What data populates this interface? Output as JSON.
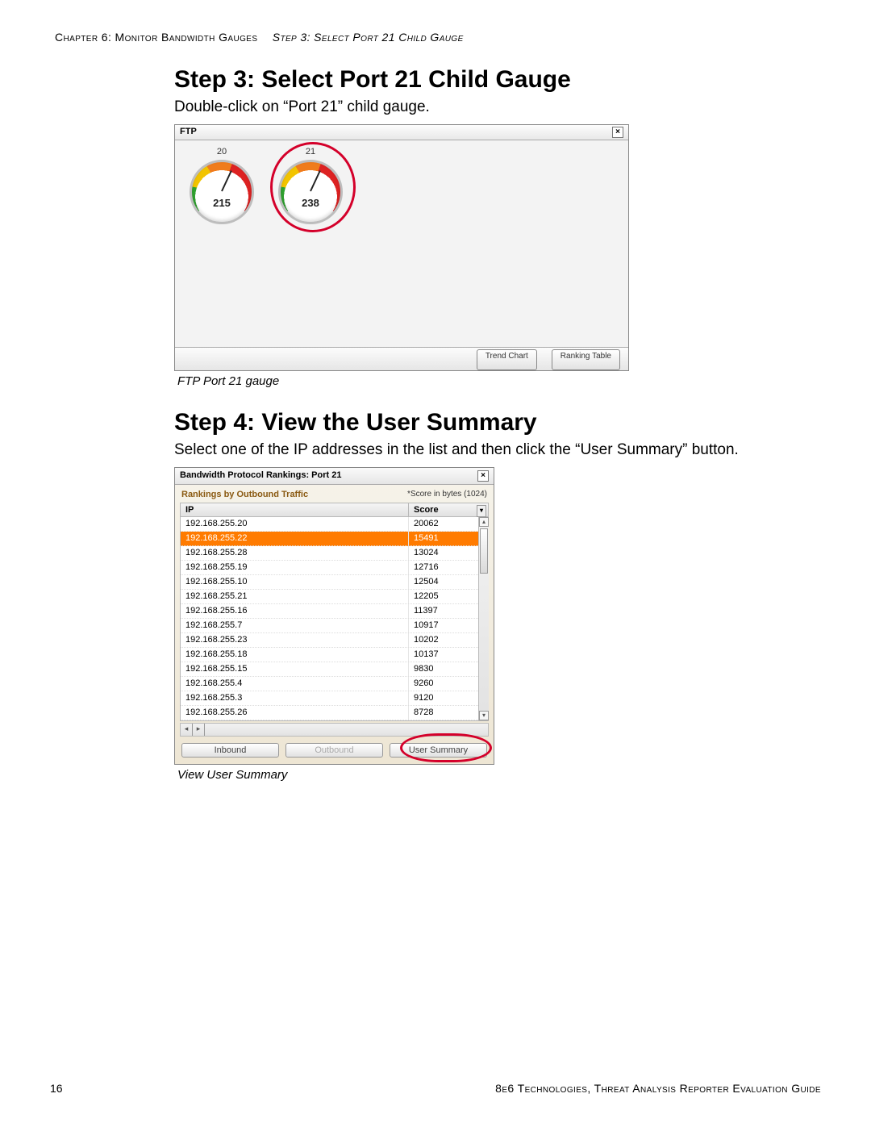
{
  "header": {
    "chapter": "Chapter 6: Monitor Bandwidth Gauges",
    "stepRef": "Step 3: Select Port 21 Child Gauge"
  },
  "step3": {
    "title": "Step 3: Select Port 21 Child Gauge",
    "body": "Double-click on “Port 21” child gauge.",
    "caption": "FTP Port 21 gauge"
  },
  "ftpPanel": {
    "title": "FTP",
    "close": "×",
    "gauges": [
      {
        "port": "20",
        "value": "215",
        "highlight": false
      },
      {
        "port": "21",
        "value": "238",
        "highlight": true
      }
    ],
    "buttons": {
      "trend": "Trend Chart",
      "ranking": "Ranking Table"
    }
  },
  "step4": {
    "title": "Step 4: View the User Summary",
    "body": "Select one of the IP addresses in the list and then click the “User Summary” button.",
    "caption": "View User Summary"
  },
  "rankPanel": {
    "title": "Bandwidth Protocol Rankings: Port 21",
    "close": "×",
    "subLeft": "Rankings by Outbound Traffic",
    "subRight": "*Score in bytes (1024)",
    "col1": "IP",
    "col2": "Score",
    "rows": [
      {
        "ip": "192.168.255.20",
        "score": "20062",
        "sel": false
      },
      {
        "ip": "192.168.255.22",
        "score": "15491",
        "sel": true
      },
      {
        "ip": "192.168.255.28",
        "score": "13024",
        "sel": false
      },
      {
        "ip": "192.168.255.19",
        "score": "12716",
        "sel": false
      },
      {
        "ip": "192.168.255.10",
        "score": "12504",
        "sel": false
      },
      {
        "ip": "192.168.255.21",
        "score": "12205",
        "sel": false
      },
      {
        "ip": "192.168.255.16",
        "score": "11397",
        "sel": false
      },
      {
        "ip": "192.168.255.7",
        "score": "10917",
        "sel": false
      },
      {
        "ip": "192.168.255.23",
        "score": "10202",
        "sel": false
      },
      {
        "ip": "192.168.255.18",
        "score": "10137",
        "sel": false
      },
      {
        "ip": "192.168.255.15",
        "score": "9830",
        "sel": false
      },
      {
        "ip": "192.168.255.4",
        "score": "9260",
        "sel": false
      },
      {
        "ip": "192.168.255.3",
        "score": "9120",
        "sel": false
      },
      {
        "ip": "192.168.255.26",
        "score": "8728",
        "sel": false
      }
    ],
    "buttons": {
      "inbound": "Inbound",
      "outbound": "Outbound",
      "userSummary": "User Summary"
    }
  },
  "footer": {
    "page": "16",
    "book": "8e6 Technologies, Threat Analysis Reporter Evaluation Guide"
  }
}
